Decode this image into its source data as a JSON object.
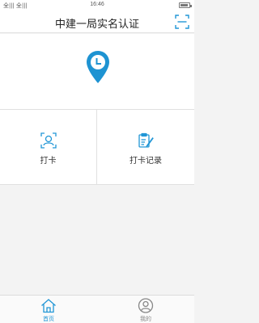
{
  "status_bar": {
    "signal_text": "全||| 全|||",
    "time": "16:46"
  },
  "header": {
    "title": "中建一局实名认证",
    "scan_icon": "scan-icon"
  },
  "hero": {
    "icon": "location-clock-pin-icon",
    "accent_color": "#1e93d2"
  },
  "actions": [
    {
      "label": "打卡",
      "icon": "face-scan-icon"
    },
    {
      "label": "打卡记录",
      "icon": "clipboard-edit-icon"
    }
  ],
  "tabbar": {
    "active_color": "#2196d6",
    "inactive_color": "#888888",
    "tabs": [
      {
        "label": "首页",
        "icon": "home-icon",
        "active": true
      },
      {
        "label": "我的",
        "icon": "user-circle-icon",
        "active": false
      }
    ]
  }
}
